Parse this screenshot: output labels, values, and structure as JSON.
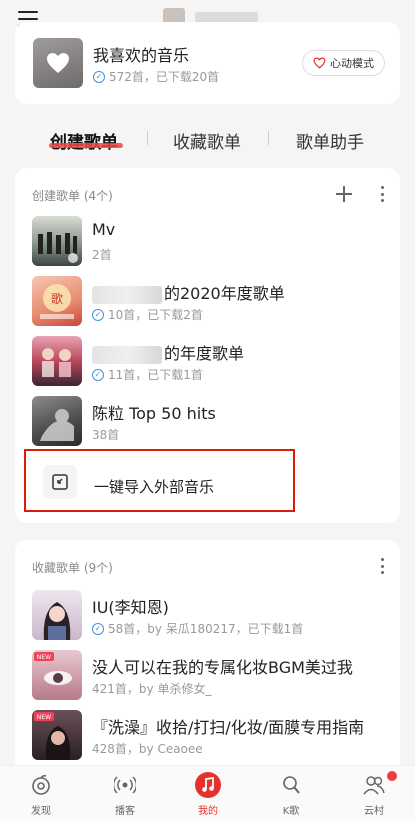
{
  "header": {
    "menu_icon": "hamburger-icon"
  },
  "liked": {
    "title": "我喜欢的音乐",
    "subtitle": "572首，已下载20首",
    "mode_button": "心动模式"
  },
  "tabs": [
    "创建歌单",
    "收藏歌单",
    "歌单助手"
  ],
  "created": {
    "header": "创建歌单 (4个)",
    "playlists": [
      {
        "title": "Mv",
        "subtitle": "2首",
        "downloaded": false
      },
      {
        "title": "的2020年度歌单",
        "subtitle": "10首，已下载2首",
        "downloaded": true
      },
      {
        "title": "的年度歌单",
        "subtitle": "11首，已下载1首",
        "downloaded": true
      },
      {
        "title": "陈粒 Top 50 hits",
        "subtitle": "38首",
        "downloaded": false
      }
    ],
    "import_label": "一键导入外部音乐"
  },
  "favorites": {
    "header": "收藏歌单 (9个)",
    "playlists": [
      {
        "title": "IU(李知恩)",
        "subtitle": "58首，by 呆瓜180217，已下载1首",
        "downloaded": true
      },
      {
        "title": "没人可以在我的专属化妆BGM美过我",
        "subtitle": "421首，by 单杀修女_",
        "downloaded": false
      },
      {
        "title": "『洗澡』收拾/打扫/化妆/面膜专用指南",
        "subtitle": "428首，by Ceaoee",
        "downloaded": false
      }
    ],
    "new_badge": "NEW"
  },
  "nav": [
    {
      "label": "发现",
      "icon": "discover-icon"
    },
    {
      "label": "播客",
      "icon": "podcast-icon"
    },
    {
      "label": "我的",
      "icon": "music-note-icon"
    },
    {
      "label": "K歌",
      "icon": "karaoke-icon"
    },
    {
      "label": "云村",
      "icon": "community-icon"
    }
  ],
  "colors": {
    "accent": "#e5312b",
    "highlight_box": "#d81e06"
  }
}
